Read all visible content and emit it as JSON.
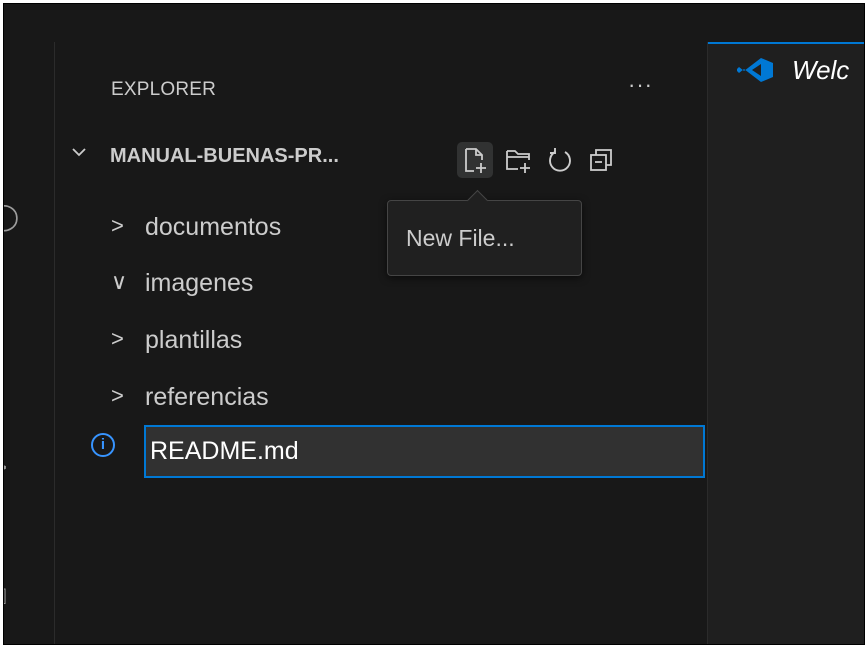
{
  "explorer": {
    "title": "EXPLORER",
    "more_label": "···",
    "root": {
      "label": "MANUAL-BUENAS-PR...",
      "expanded": true
    },
    "actions": [
      {
        "name": "new-file",
        "icon": "new-file-icon"
      },
      {
        "name": "new-folder",
        "icon": "new-folder-icon"
      },
      {
        "name": "refresh",
        "icon": "refresh-icon"
      },
      {
        "name": "collapse-all",
        "icon": "collapse-all-icon"
      }
    ],
    "items": [
      {
        "label": "documentos",
        "chevron": ">",
        "expanded": false
      },
      {
        "label": "imagenes",
        "chevron": "∨",
        "expanded": true
      },
      {
        "label": "plantillas",
        "chevron": ">",
        "expanded": false
      },
      {
        "label": "referencias",
        "chevron": ">",
        "expanded": false
      }
    ],
    "rename_input": {
      "value": "README.md",
      "icon": "info-icon"
    }
  },
  "tooltip": {
    "text": "New File..."
  },
  "editor": {
    "tab_label": "Welc"
  },
  "colors": {
    "background": "#181818",
    "accent": "#0078d4",
    "text": "#cccccc",
    "info": "#3794ff"
  }
}
